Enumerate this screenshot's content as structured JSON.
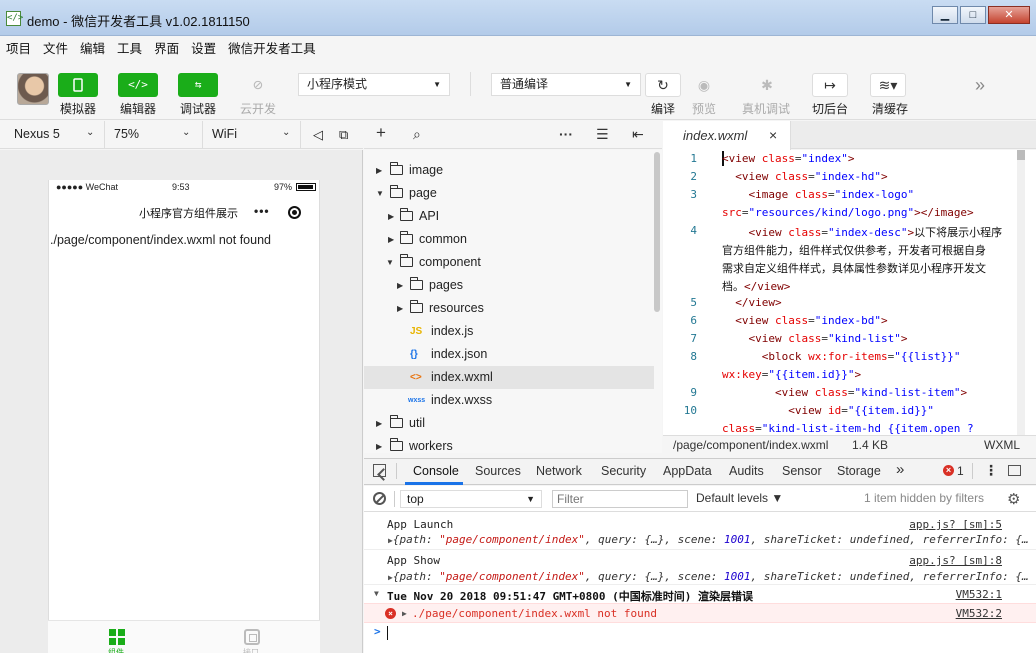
{
  "window": {
    "title": "demo - 微信开发者工具 v1.02.1811150",
    "minimize": "▁",
    "maximize": "□",
    "close": "✕"
  },
  "menu": [
    "项目",
    "文件",
    "编辑",
    "工具",
    "界面",
    "设置",
    "微信开发者工具"
  ],
  "toolbar": {
    "simulator_label": "模拟器",
    "editor_label": "编辑器",
    "debugger_label": "调试器",
    "cloud_label": "云开发",
    "mode_select": "小程序模式",
    "compile_select": "普通编译",
    "compile_label": "编译",
    "preview_label": "预览",
    "remote_debug_label": "真机调试",
    "switch_bg_label": "切后台",
    "clear_cache_label": "清缓存",
    "more": "»"
  },
  "device_bar": {
    "device": "Nexus 5",
    "zoom": "75%",
    "network": "WiFi"
  },
  "simulator": {
    "carrier": "●●●●● WeChat",
    "time": "9:53",
    "battery": "97%",
    "nav_title": "小程序官方组件展示",
    "capsule_dots": "•••",
    "error_message": "./page/component/index.wxml not found",
    "tab1_label": "组件",
    "tab2_label": "接口"
  },
  "file_tree": {
    "rows": [
      {
        "label": "image",
        "type": "folder",
        "expanded": false
      },
      {
        "label": "page",
        "type": "folder",
        "expanded": true
      },
      {
        "label": "API",
        "type": "folder",
        "expanded": false
      },
      {
        "label": "common",
        "type": "folder",
        "expanded": false
      },
      {
        "label": "component",
        "type": "folder",
        "expanded": true
      },
      {
        "label": "pages",
        "type": "folder",
        "expanded": false
      },
      {
        "label": "resources",
        "type": "folder",
        "expanded": false
      },
      {
        "label": "index.js",
        "type": "js",
        "icon": "JS"
      },
      {
        "label": "index.json",
        "type": "json",
        "icon": "{}"
      },
      {
        "label": "index.wxml",
        "type": "wxml",
        "icon": "<>",
        "selected": true
      },
      {
        "label": "index.wxss",
        "type": "wxss",
        "icon": "wxss"
      },
      {
        "label": "util",
        "type": "folder",
        "expanded": false
      },
      {
        "label": "workers",
        "type": "folder",
        "expanded": false
      }
    ]
  },
  "editor": {
    "tab_name": "index.wxml",
    "tab_close": "×",
    "line_numbers": [
      "1",
      "2",
      "3",
      "4",
      "5",
      "6",
      "7",
      "8",
      "9",
      "10"
    ],
    "status_path": "/page/component/index.wxml",
    "status_size": "1.4 KB",
    "status_lang": "WXML"
  },
  "devtools": {
    "tabs": [
      "Console",
      "Sources",
      "Network",
      "Security",
      "AppData",
      "Audits",
      "Sensor",
      "Storage"
    ],
    "tabs_more": "»",
    "error_count": "1",
    "context": "top",
    "filter_placeholder": "Filter",
    "levels": "Default levels ▼",
    "hidden_info": "1 item hidden by filters",
    "logs": [
      {
        "text": "App Launch",
        "src": "app.js? [sm]:5",
        "detail": "▶{path: \"page/component/index\", query: {…}, scene: 1001, shareTicket: undefined, referrerInfo: {…"
      },
      {
        "text": "App Show",
        "src": "app.js? [sm]:8",
        "detail": "▶{path: \"page/component/index\", query: {…}, scene: 1001, shareTicket: undefined, referrerInfo: {…"
      },
      {
        "text": "Tue Nov 20 2018 09:51:47 GMT+0800 (中国标准时间) 渲染层错误",
        "src": "VM532:1"
      },
      {
        "text": "./page/component/index.wxml not found",
        "src": "VM532:2"
      }
    ],
    "prompt": ">"
  },
  "colors": {
    "accent_green": "#1aad19",
    "error_red": "#d93025",
    "link_blue": "#1a73e8"
  }
}
